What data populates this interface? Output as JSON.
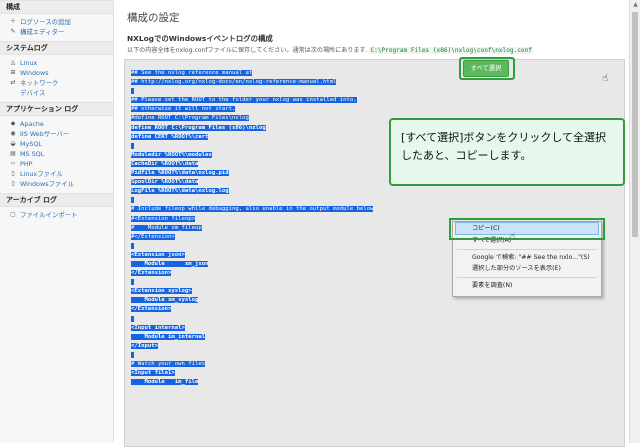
{
  "sidebar": {
    "sections": [
      {
        "title": "構成",
        "items": [
          {
            "icon": "＋",
            "icon_name": "plus-icon",
            "label": "ログソースの追加"
          },
          {
            "icon": "✎",
            "icon_name": "pencil-icon",
            "label": "構成エディター"
          }
        ]
      },
      {
        "title": "システムログ",
        "items": [
          {
            "icon": "◬",
            "icon_name": "linux-icon",
            "label": "Linux"
          },
          {
            "icon": "⊞",
            "icon_name": "windows-icon",
            "label": "Windows"
          },
          {
            "icon": "⇄",
            "icon_name": "network-icon",
            "label": "ネットワーク"
          },
          {
            "icon": "",
            "icon_name": "",
            "label": "デバイス",
            "sub": true
          }
        ]
      },
      {
        "title": "アプリケーション ログ",
        "items": [
          {
            "icon": "◆",
            "icon_name": "apache-icon",
            "label": "Apache"
          },
          {
            "icon": "◉",
            "icon_name": "iis-icon",
            "label": "IIS Webサーバー"
          },
          {
            "icon": "◒",
            "icon_name": "mysql-icon",
            "label": "MySQL"
          },
          {
            "icon": "▤",
            "icon_name": "mssql-icon",
            "label": "MS SQL"
          },
          {
            "icon": "‹›",
            "icon_name": "php-icon",
            "label": "PHP"
          },
          {
            "icon": "▯",
            "icon_name": "linux-file-icon",
            "label": "Linuxファイル"
          },
          {
            "icon": "▯",
            "icon_name": "windows-file-icon",
            "label": "Windowsファイル"
          }
        ]
      },
      {
        "title": "アーカイブ ログ",
        "items": [
          {
            "icon": "▢",
            "icon_name": "file-import-icon",
            "label": "ファイルインポート"
          }
        ]
      }
    ]
  },
  "main": {
    "page_title": "構成の設定",
    "subtitle": "NXLogでのWindowsイベントログの構成",
    "description": "以下の内容全体をnxlog.confファイルに保存してください。通常は次の場所にあります.",
    "config_path": "C:\\Program Files (x86)\\nxlog\\conf\\nxlog.conf",
    "select_all_label": "すべて選択"
  },
  "config_lines": [
    {
      "t": "## See the nxlog reference manual at",
      "b": false
    },
    {
      "t": "## http://nxlog.org/nxlog-docs/en/nxlog-reference-manual.html",
      "b": false
    },
    {
      "t": "",
      "b": false
    },
    {
      "t": "## Please set the ROOT to the folder your nxlog was installed into,",
      "b": false
    },
    {
      "t": "## otherwise it will not start.",
      "b": false
    },
    {
      "t": "#define ROOT C:\\Program Files\\nxlog",
      "b": false
    },
    {
      "t": "define ROOT C:\\Program Files (x86)\\nxlog",
      "b": true
    },
    {
      "t": "define CERT %ROOT%\\cert",
      "b": true
    },
    {
      "t": "",
      "b": false
    },
    {
      "t": "Moduledir %ROOT%\\modules",
      "b": true
    },
    {
      "t": "CacheDir %ROOT%\\data",
      "b": true
    },
    {
      "t": "Pidfile %ROOT%\\data\\nxlog.pid",
      "b": true
    },
    {
      "t": "SpoolDir %ROOT%\\data",
      "b": true
    },
    {
      "t": "LogFile %ROOT%\\data\\nxlog.log",
      "b": true
    },
    {
      "t": "",
      "b": false
    },
    {
      "t": "# Include fileop while debugging, also enable in the output module below",
      "b": false
    },
    {
      "t": "#<Extension fileop>",
      "b": false
    },
    {
      "t": "#    Module xm_fileop",
      "b": false
    },
    {
      "t": "#</Extension>",
      "b": false
    },
    {
      "t": "",
      "b": false
    },
    {
      "t": "<Extension json>",
      "b": true
    },
    {
      "t": "    Module      xm_json",
      "b": true
    },
    {
      "t": "</Extension>",
      "b": true
    },
    {
      "t": "",
      "b": false
    },
    {
      "t": "<Extension syslog>",
      "b": true
    },
    {
      "t": "    Module xm_syslog",
      "b": true
    },
    {
      "t": "</Extension>",
      "b": true
    },
    {
      "t": "",
      "b": false
    },
    {
      "t": "<Input internal>",
      "b": true
    },
    {
      "t": "    Module im_internal",
      "b": true
    },
    {
      "t": "</Input>",
      "b": true
    },
    {
      "t": "",
      "b": false
    },
    {
      "t": "# Watch your own files",
      "b": false
    },
    {
      "t": "<Input file1>",
      "b": true
    },
    {
      "t": "    Module   im_file",
      "b": true
    }
  ],
  "callout": {
    "text": "[すべて選択]ボタンをクリックして全選択したあと、コピーします。"
  },
  "context_menu": {
    "items": [
      {
        "label": "コピー(C)",
        "selected": true
      },
      {
        "label": "すべて選択(A)",
        "selected": false
      },
      {
        "sep": true
      },
      {
        "label": "Google で検索: \"## See the nxlo...\"(S)",
        "selected": false
      },
      {
        "label": "選択した部分のソースを表示(E)",
        "selected": false
      },
      {
        "sep": true
      },
      {
        "label": "要素を調査(N)",
        "selected": false
      }
    ]
  },
  "colors": {
    "selection": "#1664e0",
    "accent_green": "#5cb85c",
    "highlight_border": "#2f9e3f",
    "link": "#2a6fb5"
  }
}
